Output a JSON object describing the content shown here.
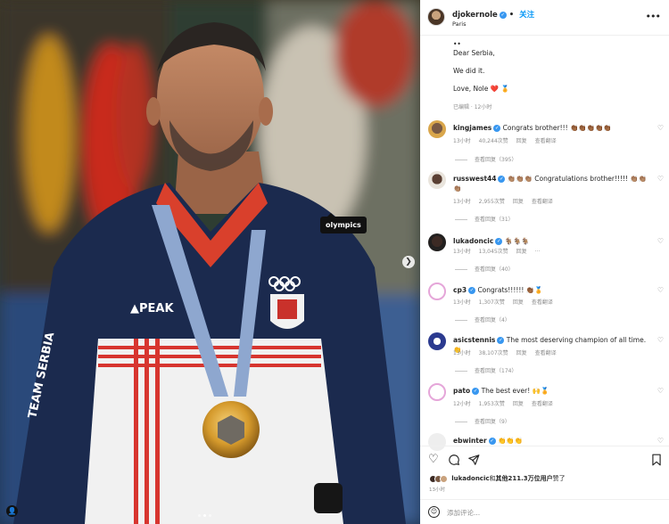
{
  "photo": {
    "tag_label": "olympics",
    "next_icon": "chevron-right-icon",
    "user_tag_icon": "person-icon",
    "carousel_count": 3,
    "carousel_active": 2
  },
  "header": {
    "username": "djokernole",
    "follow_label": "关注",
    "location": "Paris",
    "more_icon": "more-icon",
    "separator": "•"
  },
  "caption": {
    "lines": [
      "••",
      "Dear Serbia,",
      "We did it.",
      "Love, Nole ❤️ 🏅"
    ],
    "meta": "已编辑 · 12小时"
  },
  "comments": [
    {
      "user": "kingjames",
      "text": "Congrats brother!!! 👏🏾👏🏾👏🏾👏🏾👏🏾",
      "time": "13小时",
      "likes": "40,244次赞",
      "reply": "回复",
      "translate": "查看翻译",
      "replies": "查看回复（395）"
    },
    {
      "user": "russwest44",
      "text": "👏🏽👏🏽👏🏽 Congratulations brother!!!!! 👏🏽👏🏽👏🏽",
      "time": "13小时",
      "likes": "2,955次赞",
      "reply": "回复",
      "translate": "查看翻译",
      "replies": "查看回复（31）"
    },
    {
      "user": "lukadoncic",
      "text": "🐐🐐🐐",
      "time": "13小时",
      "likes": "13,045次赞",
      "reply": "回复",
      "translate": "···",
      "replies": "查看回复（40）"
    },
    {
      "user": "cp3",
      "text": "Congrats!!!!!! 👏🏾🏅",
      "time": "13小时",
      "likes": "1,307次赞",
      "reply": "回复",
      "translate": "查看翻译",
      "replies": "查看回复（4）"
    },
    {
      "user": "asicstennis",
      "text": "The most deserving champion of all time. 👏",
      "time": "13小时",
      "likes": "38,107次赞",
      "reply": "回复",
      "translate": "查看翻译",
      "replies": "查看回复（174）"
    },
    {
      "user": "pato",
      "text": "The best ever! 🙌🏅",
      "time": "12小时",
      "likes": "1,953次赞",
      "reply": "回复",
      "translate": "查看翻译",
      "replies": "查看回复（9）"
    },
    {
      "user": "ebwinter",
      "text": "👏👏👏",
      "time": "",
      "likes": "",
      "reply": "",
      "translate": "",
      "replies": ""
    }
  ],
  "actions": {
    "like_icon": "heart-icon",
    "comment_icon": "comment-icon",
    "share_icon": "send-icon",
    "save_icon": "bookmark-icon"
  },
  "likes": {
    "user": "lukadoncic",
    "text_mid": "和",
    "text_bold": "其他211.3万位用户",
    "text_end": "赞了"
  },
  "post_time": "13小时",
  "composer": {
    "placeholder": "添加评论...",
    "emoji_icon": "emoji-icon"
  },
  "colors": {
    "accent": "#0095f6",
    "verified": "#3897f0",
    "heart": "#ed4956"
  }
}
